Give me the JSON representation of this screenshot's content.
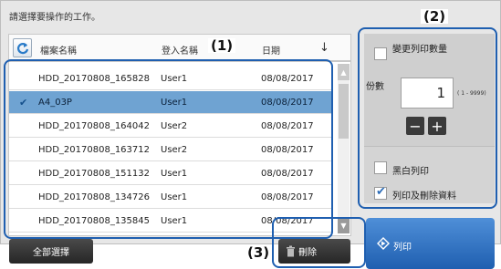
{
  "instruction": "請選擇要操作的工作。",
  "list": {
    "columns": {
      "file_name": "檔案名稱",
      "login_name": "登入名稱",
      "date": "日期"
    },
    "rows": [
      {
        "file": "HDD_20170808_165828",
        "user": "User1",
        "date": "08/08/2017",
        "selected": false
      },
      {
        "file": "A4_03P",
        "user": "User1",
        "date": "08/08/2017",
        "selected": true
      },
      {
        "file": "HDD_20170808_164042",
        "user": "User2",
        "date": "08/08/2017",
        "selected": false
      },
      {
        "file": "HDD_20170808_163712",
        "user": "User2",
        "date": "08/08/2017",
        "selected": false
      },
      {
        "file": "HDD_20170808_151132",
        "user": "User1",
        "date": "08/08/2017",
        "selected": false
      },
      {
        "file": "HDD_20170808_134726",
        "user": "User1",
        "date": "08/08/2017",
        "selected": false
      },
      {
        "file": "HDD_20170808_135845",
        "user": "User1",
        "date": "08/08/2017",
        "selected": false
      }
    ]
  },
  "callouts": {
    "c1": "(1)",
    "c2": "(2)",
    "c3": "(3)"
  },
  "settings": {
    "change_copies_label": "變更列印數量",
    "copies_label": "份數",
    "copies_value": "1",
    "copies_range": "( 1 - 9999)",
    "minus": "−",
    "plus": "+",
    "bw_print_label": "黑白列印",
    "print_delete_label": "列印及刪除資料",
    "change_copies_checked": false,
    "bw_print_checked": false,
    "print_delete_checked": true
  },
  "buttons": {
    "select_all": "全部選擇",
    "delete": "刪除",
    "print": "列印"
  },
  "colors": {
    "accent": "#1f5fb0",
    "selected_row": "#6fa3d2"
  },
  "icons": {
    "refresh": "refresh-icon",
    "sort": "sort-icon",
    "check": "check-icon",
    "trash": "trash-icon",
    "print": "print-icon"
  }
}
